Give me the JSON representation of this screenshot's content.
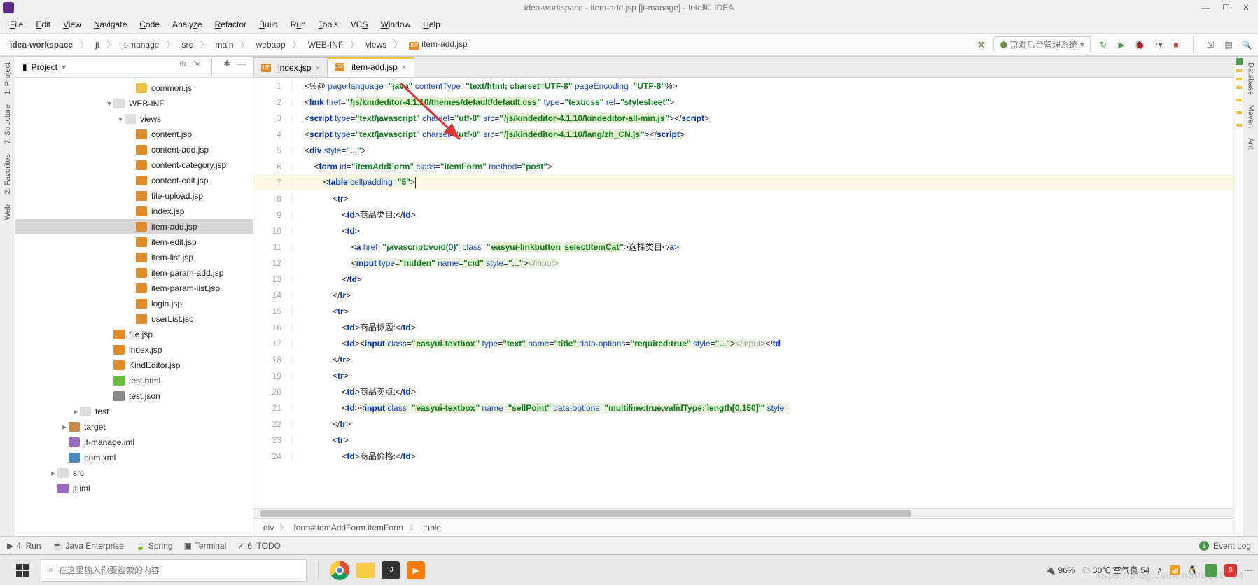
{
  "window": {
    "title": "idea-workspace - item-add.jsp [jt-manage] - IntelliJ IDEA"
  },
  "menu": [
    "File",
    "Edit",
    "View",
    "Navigate",
    "Code",
    "Analyze",
    "Refactor",
    "Build",
    "Run",
    "Tools",
    "VCS",
    "Window",
    "Help"
  ],
  "breadcrumbs": [
    "idea-workspace",
    "jt",
    "jt-manage",
    "src",
    "main",
    "webapp",
    "WEB-INF",
    "views",
    "item-add.jsp"
  ],
  "runConfig": "京淘后台管理系统",
  "projectPanel": {
    "title": "Project"
  },
  "tree": [
    {
      "indent": 10,
      "icon": "js",
      "label": "common.js"
    },
    {
      "indent": 8,
      "caret": "▾",
      "icon": "folder",
      "label": "WEB-INF"
    },
    {
      "indent": 9,
      "caret": "▾",
      "icon": "folder",
      "label": "views"
    },
    {
      "indent": 10,
      "icon": "jsp",
      "label": "content.jsp"
    },
    {
      "indent": 10,
      "icon": "jsp",
      "label": "content-add.jsp"
    },
    {
      "indent": 10,
      "icon": "jsp",
      "label": "content-category.jsp"
    },
    {
      "indent": 10,
      "icon": "jsp",
      "label": "content-edit.jsp"
    },
    {
      "indent": 10,
      "icon": "jsp",
      "label": "file-upload.jsp"
    },
    {
      "indent": 10,
      "icon": "jsp",
      "label": "index.jsp"
    },
    {
      "indent": 10,
      "icon": "jsp",
      "label": "item-add.jsp",
      "selected": true
    },
    {
      "indent": 10,
      "icon": "jsp",
      "label": "item-edit.jsp"
    },
    {
      "indent": 10,
      "icon": "jsp",
      "label": "item-list.jsp"
    },
    {
      "indent": 10,
      "icon": "jsp",
      "label": "item-param-add.jsp"
    },
    {
      "indent": 10,
      "icon": "jsp",
      "label": "item-param-list.jsp"
    },
    {
      "indent": 10,
      "icon": "jsp",
      "label": "login.jsp"
    },
    {
      "indent": 10,
      "icon": "jsp",
      "label": "userList.jsp"
    },
    {
      "indent": 8,
      "icon": "jsp",
      "label": "file.jsp"
    },
    {
      "indent": 8,
      "icon": "jsp",
      "label": "index.jsp"
    },
    {
      "indent": 8,
      "icon": "jsp",
      "label": "KindEditor.jsp"
    },
    {
      "indent": 8,
      "icon": "html",
      "label": "test.html"
    },
    {
      "indent": 8,
      "icon": "json",
      "label": "test.json"
    },
    {
      "indent": 5,
      "caret": "▸",
      "icon": "folder",
      "label": "test"
    },
    {
      "indent": 4,
      "caret": "▸",
      "icon": "folder brown",
      "label": "target"
    },
    {
      "indent": 4,
      "icon": "iml",
      "label": "jt-manage.iml"
    },
    {
      "indent": 4,
      "icon": "xml",
      "label": "pom.xml",
      "blue": true
    },
    {
      "indent": 3,
      "caret": "▸",
      "icon": "folder",
      "label": "src"
    },
    {
      "indent": 3,
      "icon": "iml",
      "label": "jt.iml"
    }
  ],
  "tabs": [
    {
      "label": "index.jsp",
      "active": false
    },
    {
      "label": "item-add.jsp",
      "active": true
    }
  ],
  "gutters": [
    "1",
    "2",
    "3",
    "4",
    "5",
    "6",
    "7",
    "8",
    "9",
    "10",
    "11",
    "12",
    "13",
    "14",
    "15",
    "16",
    "17",
    "18",
    "19",
    "20",
    "21",
    "22",
    "23",
    "24"
  ],
  "editorBreadcrumbs": [
    "div",
    "form#itemAddForm.itemForm",
    "table"
  ],
  "leftTools": [
    "1: Project",
    "7: Structure",
    "2: Favorites",
    "Web"
  ],
  "rightTools": [
    "Database",
    "Maven",
    "Ant"
  ],
  "bottomTools": [
    "4: Run",
    "Java Enterprise",
    "Spring",
    "Terminal",
    "6: TODO"
  ],
  "eventLog": "Event Log",
  "taskbar": {
    "search_placeholder": "在这里输入你要搜索的内容",
    "weather": "30℃ 空气良 54",
    "battery": "96%"
  },
  "watermark": "https://blog.csdn.net/qq36434"
}
